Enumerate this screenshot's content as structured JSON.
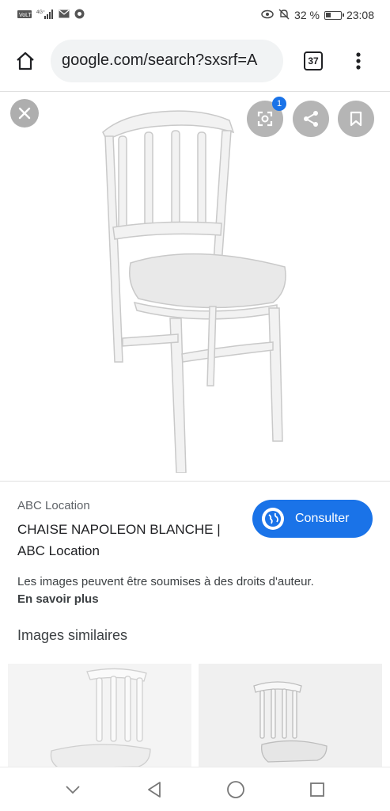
{
  "status_bar": {
    "left_icons": [
      "volte-icon",
      "signal-icon",
      "mail-icon",
      "vpn-icon"
    ],
    "battery_percent": "32 %",
    "time": "23:08"
  },
  "browser": {
    "url": "google.com/search?sxsrf=A",
    "tab_count": "37"
  },
  "lens_badge": "1",
  "result": {
    "source": "ABC Location",
    "title": "CHAISE NAPOLEON BLANCHE | ABC Location",
    "consult_label": "Consulter",
    "copyright": "Les images peuvent être soumises à des droits d'auteur.",
    "learn_more": "En savoir plus"
  },
  "similar": {
    "title": "Images similaires"
  },
  "colors": {
    "accent": "#1a73e8"
  }
}
